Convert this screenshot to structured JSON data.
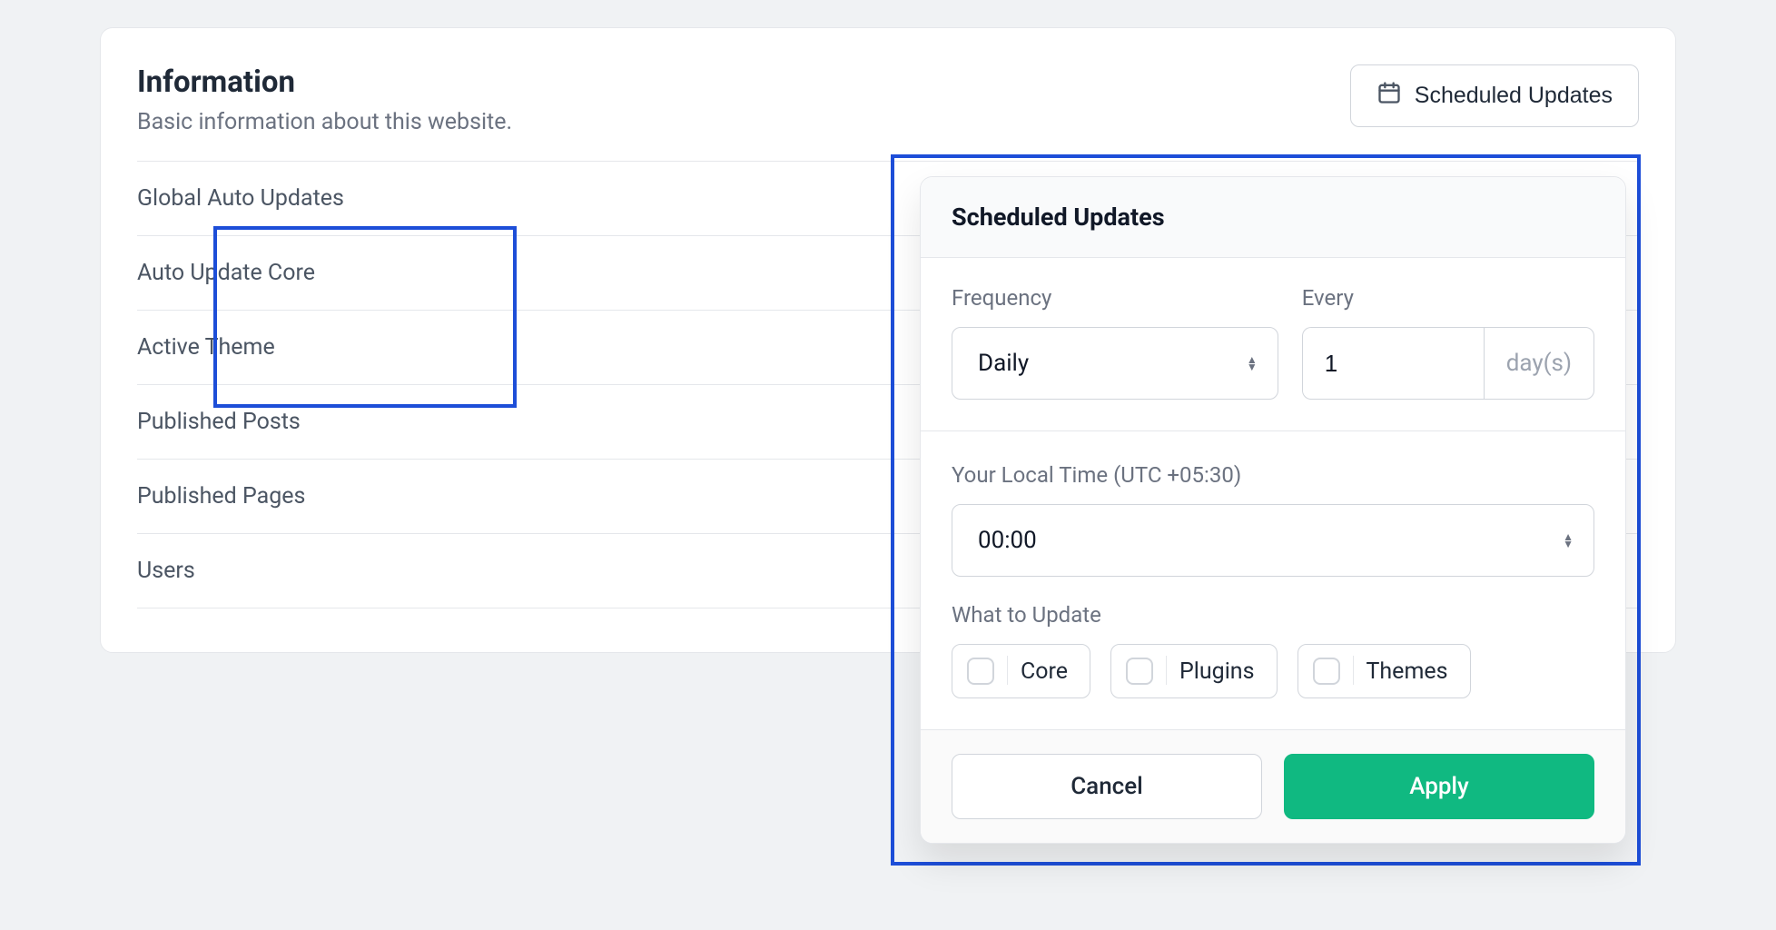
{
  "header": {
    "title": "Information",
    "subtitle": "Basic information about this website.",
    "scheduled_btn_label": "Scheduled Updates"
  },
  "info_items": [
    "Global Auto Updates",
    "Auto Update Core",
    "Active Theme",
    "Published Posts",
    "Published Pages",
    "Users"
  ],
  "popover": {
    "title": "Scheduled Updates",
    "frequency_label": "Frequency",
    "frequency_value": "Daily",
    "every_label": "Every",
    "every_value": "1",
    "every_suffix": "day(s)",
    "time_label": "Your Local Time (UTC +05:30)",
    "time_value": "00:00",
    "what_label": "What to Update",
    "opts": {
      "core": "Core",
      "plugins": "Plugins",
      "themes": "Themes"
    },
    "cancel": "Cancel",
    "apply": "Apply"
  }
}
